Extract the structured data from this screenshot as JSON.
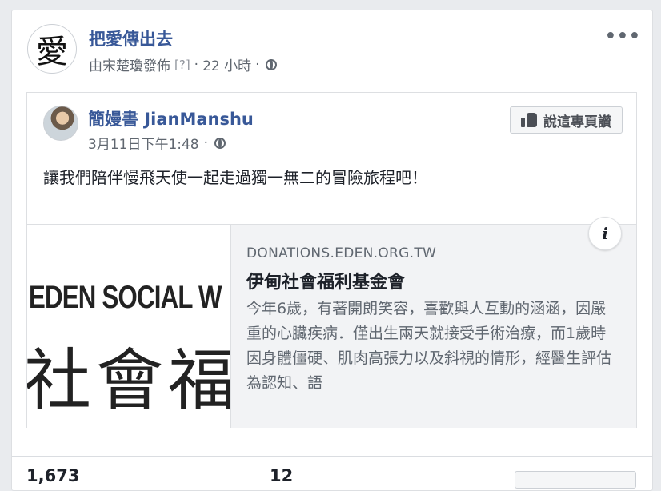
{
  "page": {
    "avatar_char": "愛",
    "name": "把愛傳出去",
    "published_by": "由宋楚瓊發佈",
    "help_mark": "[?]",
    "sep1": "·",
    "time": "22 小時",
    "sep2": "·",
    "more": "•••"
  },
  "shared_post": {
    "author": "簡嫚書 JianManshu",
    "date": "3月11日下午1:48",
    "sep": "·",
    "like_page_label": "說這專頁讚",
    "text": "讓我們陪伴慢飛天使一起走過獨一無二的冒險旅程吧！"
  },
  "link": {
    "image_text_line1": "EDEN SOCIAL W",
    "image_text_line2": "社會福",
    "domain": "DONATIONS.EDEN.ORG.TW",
    "title": "伊甸社會福利基金會",
    "description": "今年6歲，有著開朗笑容，喜歡與人互動的涵涵，因嚴重的心臟疾病．僅出生兩天就接受手術治療，而1歲時因身體僵硬、肌肉高張力以及斜視的情形，經醫生評估為認知、語",
    "info_label": "i"
  },
  "stats": {
    "reactions": "1,673",
    "comments": "12"
  },
  "colors": {
    "link_blue": "#385898",
    "meta_gray": "#606770",
    "background": "#e9ebee"
  }
}
